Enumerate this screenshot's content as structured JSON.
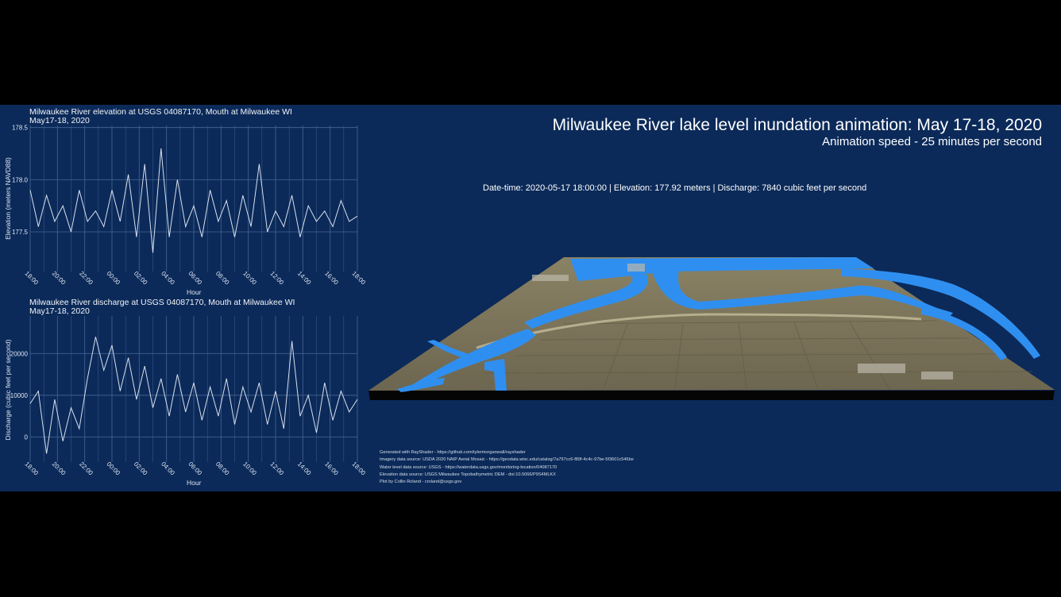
{
  "header": {
    "title": "Milwaukee River lake level inundation animation: May 17-18, 2020",
    "subtitle": "Animation speed - 25 minutes per second",
    "status": "Date-time: 2020-05-17 18:00:00 |  Elevation: 177.92 meters | Discharge: 7840 cubic feet per second"
  },
  "credits": [
    "Generated with RayShader - https://github.com/tylermorganwall/rayshader",
    "Imagery data source: USDA 2020 NAIP Aerial Mosaic - https://geodata.wisc.edu/catalog/7a797cc6-f89f-4c4c-97be-5f3601c546be",
    "Water level data source: USGS - https://waterdata.usgs.gov/monitoring-location/04087170",
    "Elevation data source: USGS Milwaukee Topobathymetric DEM - doi:10.5066/P9S4MLKX",
    "Plot by Collin Roland - croland@usgs.gov"
  ],
  "colors": {
    "panel_bg": "#0b2a59",
    "line": "#d8e0ee",
    "grid": "#3f5f8f",
    "water": "#2f8ff0",
    "land": "#7b7358"
  },
  "chart_data": [
    {
      "type": "line",
      "title": "Milwaukee River elevation at USGS 04087170, Mouth at Milwaukee WI",
      "subtitle": "May17-18, 2020",
      "xlabel": "Hour",
      "ylabel": "Elevation (meters NAVD88)",
      "xticks": [
        "18:00",
        "20:00",
        "22:00",
        "00:00",
        "02:00",
        "04:00",
        "06:00",
        "08:00",
        "10:00",
        "12:00",
        "14:00",
        "16:00",
        "18:00"
      ],
      "yticks": [
        177.5,
        178.0,
        178.5
      ],
      "ytick_labels": [
        "177.5",
        "178.0",
        "178.5"
      ],
      "ylim": [
        177.12,
        178.52
      ],
      "xlim": [
        0,
        24
      ],
      "grid": true,
      "x": [
        0,
        0.6,
        1.2,
        1.8,
        2.4,
        3,
        3.6,
        4.2,
        4.8,
        5.4,
        6,
        6.6,
        7.2,
        7.8,
        8.4,
        9,
        9.6,
        10.2,
        10.8,
        11.4,
        12,
        12.6,
        13.2,
        13.8,
        14.4,
        15,
        15.6,
        16.2,
        16.8,
        17.4,
        18,
        18.6,
        19.2,
        19.8,
        20.4,
        21,
        21.6,
        22.2,
        22.8,
        23.4,
        24
      ],
      "y": [
        177.9,
        177.55,
        177.85,
        177.6,
        177.75,
        177.5,
        177.9,
        177.6,
        177.7,
        177.55,
        177.9,
        177.6,
        178.05,
        177.45,
        178.15,
        177.3,
        178.3,
        177.45,
        178.0,
        177.55,
        177.75,
        177.45,
        177.9,
        177.6,
        177.8,
        177.45,
        177.85,
        177.55,
        178.15,
        177.5,
        177.7,
        177.55,
        177.85,
        177.45,
        177.75,
        177.6,
        177.7,
        177.55,
        177.8,
        177.6,
        177.65
      ]
    },
    {
      "type": "line",
      "title": "Milwaukee River discharge at USGS 04087170, Mouth at Milwaukee WI",
      "subtitle": "May17-18, 2020",
      "xlabel": "Hour",
      "ylabel": "Discharge (cubic feet per second)",
      "xticks": [
        "18:00",
        "20:00",
        "22:00",
        "00:00",
        "02:00",
        "04:00",
        "06:00",
        "08:00",
        "10:00",
        "12:00",
        "14:00",
        "16:00",
        "18:00"
      ],
      "yticks": [
        0,
        10000,
        20000
      ],
      "ytick_labels": [
        "0",
        "10000",
        "20000"
      ],
      "ylim": [
        -6000,
        29000
      ],
      "xlim": [
        0,
        24
      ],
      "grid": true,
      "x": [
        0,
        0.6,
        1.2,
        1.8,
        2.4,
        3,
        3.6,
        4.2,
        4.8,
        5.4,
        6,
        6.6,
        7.2,
        7.8,
        8.4,
        9,
        9.6,
        10.2,
        10.8,
        11.4,
        12,
        12.6,
        13.2,
        13.8,
        14.4,
        15,
        15.6,
        16.2,
        16.8,
        17.4,
        18,
        18.6,
        19.2,
        19.8,
        20.4,
        21,
        21.6,
        22.2,
        22.8,
        23.4,
        24
      ],
      "y": [
        8000,
        11000,
        -4000,
        9000,
        -1000,
        7000,
        2000,
        14000,
        24000,
        16000,
        22000,
        11000,
        19000,
        9000,
        17000,
        7000,
        14000,
        5000,
        15000,
        6000,
        13000,
        4000,
        12000,
        5000,
        14000,
        3000,
        12000,
        6000,
        13000,
        3000,
        11000,
        2000,
        23000,
        5000,
        10000,
        1000,
        13000,
        4000,
        11000,
        6000,
        9000
      ]
    }
  ]
}
